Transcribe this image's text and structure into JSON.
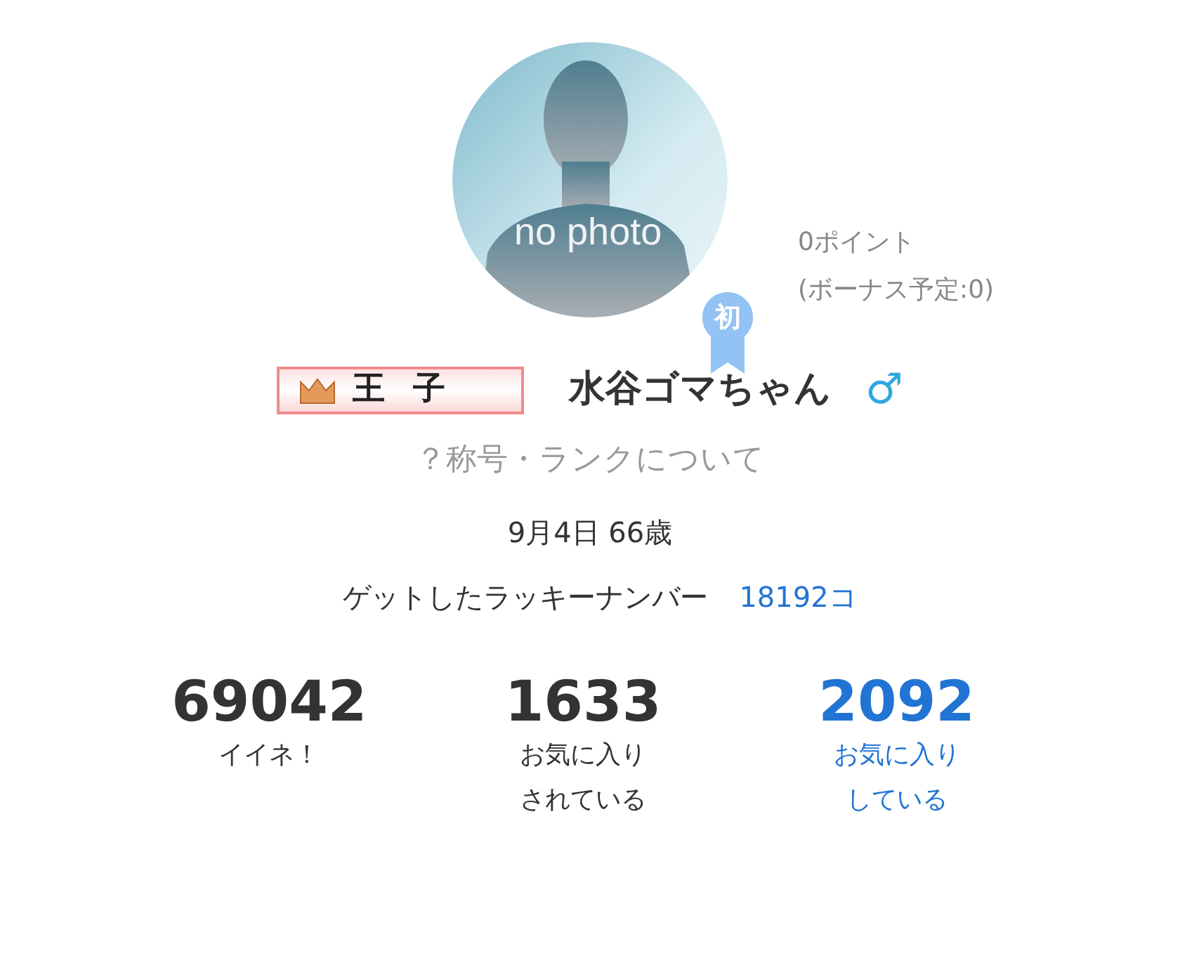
{
  "avatar": {
    "caption": "no photo",
    "badge": "初"
  },
  "points": [
    "0ポイント",
    "(ボーナス予定:0)"
  ],
  "title_badge": {
    "label": "王 子"
  },
  "user": {
    "name": "水谷ゴマちゃん",
    "gender_symbol": "♂"
  },
  "rank_link": "？称号・ランクについて",
  "birthday": "9月4日 66歳",
  "lucky": {
    "label": "ゲットしたラッキーナンバー",
    "value": "18192コ"
  },
  "stats": [
    {
      "kind": "plain",
      "value": "69042",
      "label": [
        "イイネ！"
      ]
    },
    {
      "kind": "plain",
      "value": "1633",
      "label": [
        "お気に入り",
        "されている"
      ]
    },
    {
      "kind": "link",
      "value": "2092",
      "label": [
        "お気に入り",
        "している"
      ]
    }
  ]
}
